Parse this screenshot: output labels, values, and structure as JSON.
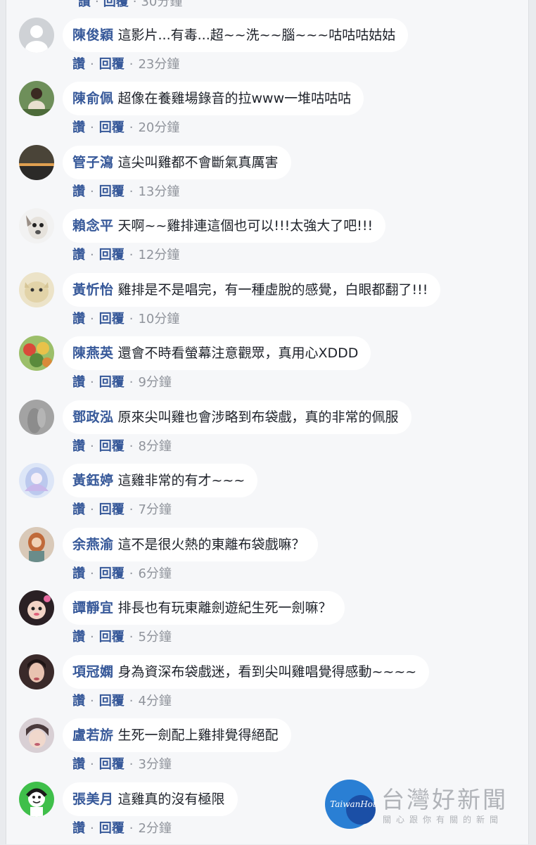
{
  "actions": {
    "like_label": "讚",
    "reply_label": "回覆",
    "separator": "·"
  },
  "partial_top": {
    "like": "讚",
    "reply": "回覆",
    "time": "30分鐘"
  },
  "comments": [
    {
      "name": "陳俊穎",
      "text": "這影片...有毒...超~~洗~~腦~~~咕咕咕姑姑",
      "time": "23分鐘",
      "avatar": "default-avatar"
    },
    {
      "name": "陳俞佩",
      "text": "超像在養雞場錄音的拉www一堆咕咕咕",
      "time": "20分鐘",
      "avatar": "photo-avatar"
    },
    {
      "name": "管子瀉",
      "text": "這尖叫雞都不會斷氣真厲害",
      "time": "13分鐘",
      "avatar": "sunset-avatar"
    },
    {
      "name": "賴念平",
      "text": "天啊~~雞排連這個也可以!!!太強大了吧!!!",
      "time": "12分鐘",
      "avatar": "dog-avatar"
    },
    {
      "name": "黃忻怡",
      "text": "雞排是不是唱完，有一種虛脫的感覺，白眼都翻了!!!",
      "time": "10分鐘",
      "avatar": "cat-avatar"
    },
    {
      "name": "陳燕英",
      "text": "還會不時看螢幕注意觀眾，真用心XDDD",
      "time": "9分鐘",
      "avatar": "toys-avatar"
    },
    {
      "name": "鄧政泓",
      "text": "原來尖叫雞也會涉略到布袋戲，真的非常的佩服",
      "time": "8分鐘",
      "avatar": "grey-avatar"
    },
    {
      "name": "黃鈺婷",
      "text": "這雞非常的有才~~~",
      "time": "7分鐘",
      "avatar": "anime-avatar"
    },
    {
      "name": "余燕渝",
      "text": "這不是很火熱的東離布袋戲嘛？",
      "time": "6分鐘",
      "avatar": "woman-avatar"
    },
    {
      "name": "譚靜宜",
      "text": "排長也有玩東離劍遊紀生死一劍嘛？",
      "time": "5分鐘",
      "avatar": "child-avatar"
    },
    {
      "name": "項冠嫻",
      "text": "身為資深布袋戲迷，看到尖叫雞唱覺得感動~~~~",
      "time": "4分鐘",
      "avatar": "portrait-avatar"
    },
    {
      "name": "盧若旂",
      "text": "生死一劍配上雞排覺得絕配",
      "time": "3分鐘",
      "avatar": "selfie-avatar"
    },
    {
      "name": "張美月",
      "text": "這雞真的沒有極限",
      "time": "2分鐘",
      "avatar": "cartoon-avatar"
    }
  ],
  "watermark": {
    "logo_text": "TaiwanHot",
    "title": "台灣好新聞",
    "subtitle": "關心跟你有關的新聞"
  }
}
